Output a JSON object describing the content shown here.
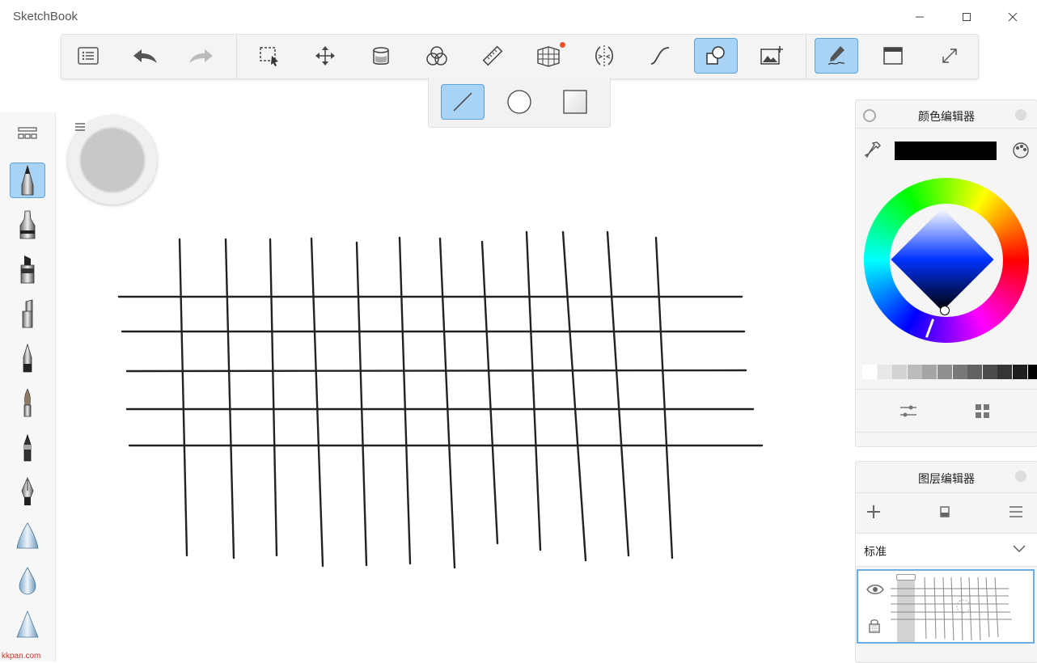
{
  "window": {
    "title": "SketchBook",
    "minimize_label": "—",
    "maximize_label": "☐",
    "close_label": "✕"
  },
  "toolbar": {
    "items": [
      {
        "id": "menu",
        "icon": "list-icon"
      },
      {
        "id": "undo",
        "icon": "undo-icon"
      },
      {
        "id": "redo",
        "icon": "redo-icon"
      },
      {
        "id": "select",
        "icon": "selection-icon"
      },
      {
        "id": "transform",
        "icon": "move-icon"
      },
      {
        "id": "fill",
        "icon": "bucket-icon"
      },
      {
        "id": "copic",
        "icon": "color-circles-icon"
      },
      {
        "id": "ruler",
        "icon": "ruler-icon"
      },
      {
        "id": "perspective",
        "icon": "perspective-grid-icon"
      },
      {
        "id": "symmetry",
        "icon": "symmetry-icon"
      },
      {
        "id": "curve",
        "icon": "curve-icon"
      },
      {
        "id": "shapes",
        "icon": "shapes-icon",
        "active": true
      },
      {
        "id": "add-image",
        "icon": "add-image-icon"
      },
      {
        "id": "stylus",
        "icon": "stylus-icon",
        "active": true
      },
      {
        "id": "window",
        "icon": "window-icon"
      },
      {
        "id": "fullscreen",
        "icon": "expand-icon"
      }
    ],
    "notification_color": "#e8542b"
  },
  "shape_bar": {
    "items": [
      {
        "id": "line",
        "icon": "line-icon",
        "active": true
      },
      {
        "id": "circle",
        "icon": "circle-icon"
      },
      {
        "id": "square",
        "icon": "square-icon"
      }
    ]
  },
  "brushes": {
    "items": [
      "pencil",
      "airbrush",
      "marker",
      "chisel-marker",
      "ballpoint-pen",
      "paintbrush",
      "ink-pen",
      "fountain-pen",
      "smear-cone",
      "blur-drop",
      "sharpen-cone"
    ],
    "active": "pencil"
  },
  "puck": {
    "color": "#c8c8c8"
  },
  "color_editor": {
    "title": "颜色编辑器",
    "current_color": "#000000",
    "grays": [
      "#ffffff",
      "#e8e8e8",
      "#d2d2d2",
      "#bcbcbc",
      "#a5a5a5",
      "#8f8f8f",
      "#787878",
      "#626262",
      "#4b4b4b",
      "#353535",
      "#1e1e1e",
      "#000000"
    ]
  },
  "layer_editor": {
    "title": "图层编辑器",
    "blend_mode": "标准"
  },
  "watermarks": {
    "left": "kkpan.com"
  }
}
